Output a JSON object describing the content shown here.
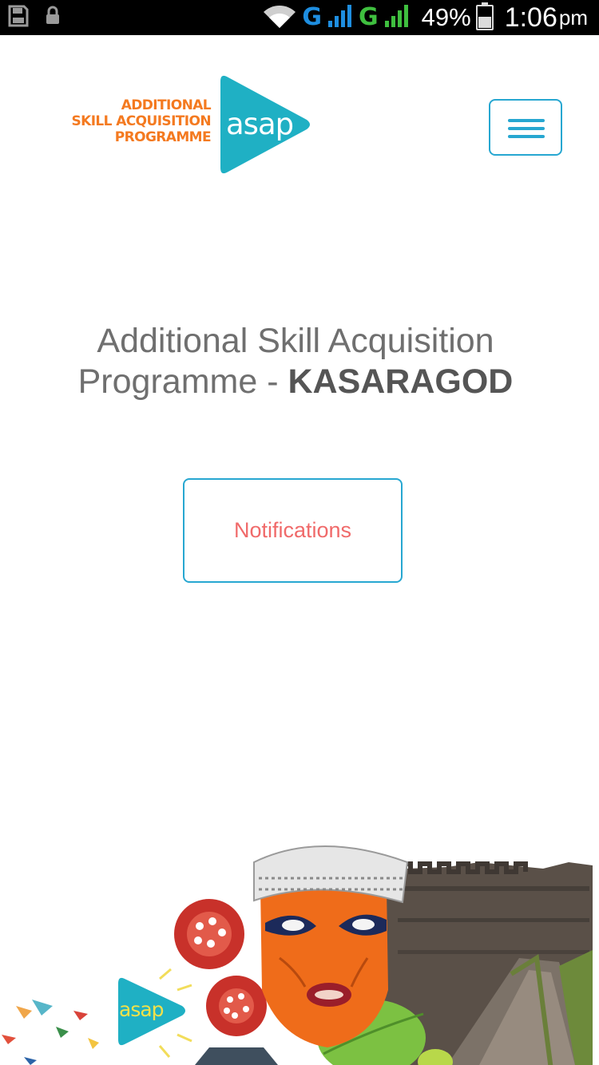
{
  "status_bar": {
    "network_1": "G",
    "network_2": "G",
    "battery": "49%",
    "time": "1:06",
    "ampm": "pm",
    "icons": [
      "sd-card-icon",
      "lock-icon",
      "wifi-icon",
      "signal-icon",
      "battery-icon"
    ]
  },
  "header": {
    "logo": {
      "line1": "ADDITIONAL",
      "line2": "SKILL ACQUISITION",
      "line3": "PROGRAMME",
      "mark": "asap"
    },
    "menu_icon": "hamburger-menu-icon"
  },
  "hero": {
    "title_light": "Additional Skill Acquisition Programme - ",
    "title_strong": "KASARAGOD",
    "notifications_label": "Notifications"
  },
  "illustration": {
    "mark": "asap"
  },
  "colors": {
    "accent": "#27a7d1",
    "logo_orange": "#f47a20",
    "notification_text": "#f06a6a",
    "title_text": "#6f6f6f"
  }
}
